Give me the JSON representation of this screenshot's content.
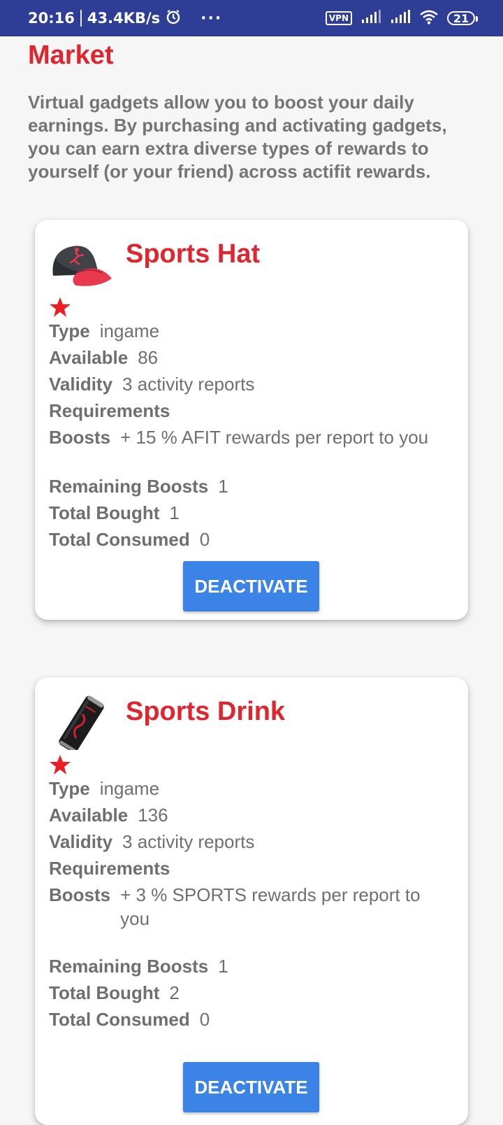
{
  "status_bar": {
    "time": "20:16",
    "speed": "43.4KB/s",
    "dots": "···",
    "vpn": "VPN",
    "battery": "21"
  },
  "page": {
    "title": "Market",
    "intro": "Virtual gadgets allow you to boost your daily earnings. By purchasing and activating gadgets, you can earn extra diverse types of rewards to yourself (or your friend) across actifit rewards."
  },
  "labels": {
    "type": "Type",
    "available": "Available",
    "validity": "Validity",
    "requirements": "Requirements",
    "boosts": "Boosts",
    "remaining_boosts": "Remaining Boosts",
    "total_bought": "Total Bought",
    "total_consumed": "Total Consumed"
  },
  "items": [
    {
      "name": "Sports Hat",
      "icon": "sports-hat-icon",
      "stars": 1,
      "type": "ingame",
      "available": "86",
      "validity": "3 activity reports",
      "requirements": "",
      "boosts": "+ 15 % AFIT rewards per report to you",
      "remaining_boosts": "1",
      "total_bought": "1",
      "total_consumed": "0",
      "button_label": "DEACTIVATE"
    },
    {
      "name": "Sports Drink",
      "icon": "sports-drink-icon",
      "stars": 1,
      "type": "ingame",
      "available": "136",
      "validity": "3 activity reports",
      "requirements": "",
      "boosts": "+ 3 % SPORTS rewards per report to you",
      "remaining_boosts": "1",
      "total_bought": "2",
      "total_consumed": "0",
      "button_label": "DEACTIVATE"
    }
  ],
  "colors": {
    "status_bar": "#2e3d96",
    "title_red": "#e0252f",
    "button_blue": "#3b83e6",
    "star_red": "#ee1c25"
  }
}
